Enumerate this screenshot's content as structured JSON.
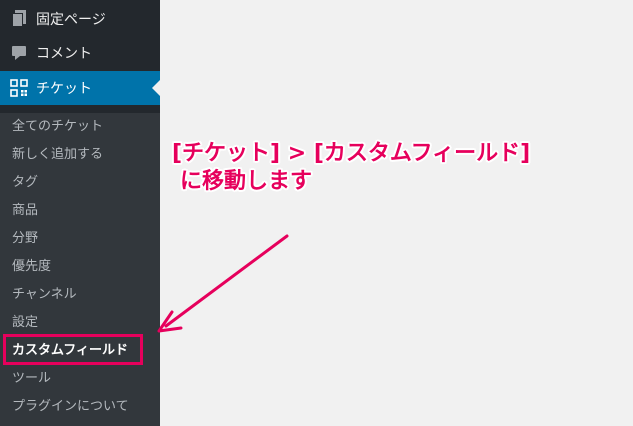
{
  "sidebar": {
    "top_items": [
      {
        "label": "固定ページ",
        "icon": "pages-icon"
      },
      {
        "label": "コメント",
        "icon": "comment-icon"
      },
      {
        "label": "チケット",
        "icon": "ticket-grid-icon",
        "current": true
      }
    ],
    "submenu": [
      {
        "label": "全てのチケット"
      },
      {
        "label": "新しく追加する"
      },
      {
        "label": "タグ"
      },
      {
        "label": "商品"
      },
      {
        "label": "分野"
      },
      {
        "label": "優先度"
      },
      {
        "label": "チャンネル"
      },
      {
        "label": "設定"
      },
      {
        "label": "カスタムフィールド",
        "active": true
      },
      {
        "label": "ツール"
      },
      {
        "label": "プラグインについて"
      }
    ]
  },
  "annotation": {
    "line1": "[チケット] > [カスタムフィールド]",
    "line2": "に移動します",
    "color": "#e6005c"
  },
  "colors": {
    "sidebar_bg": "#23282d",
    "submenu_bg": "#32373c",
    "current_bg": "#0073aa",
    "content_bg": "#f1f1f1"
  }
}
